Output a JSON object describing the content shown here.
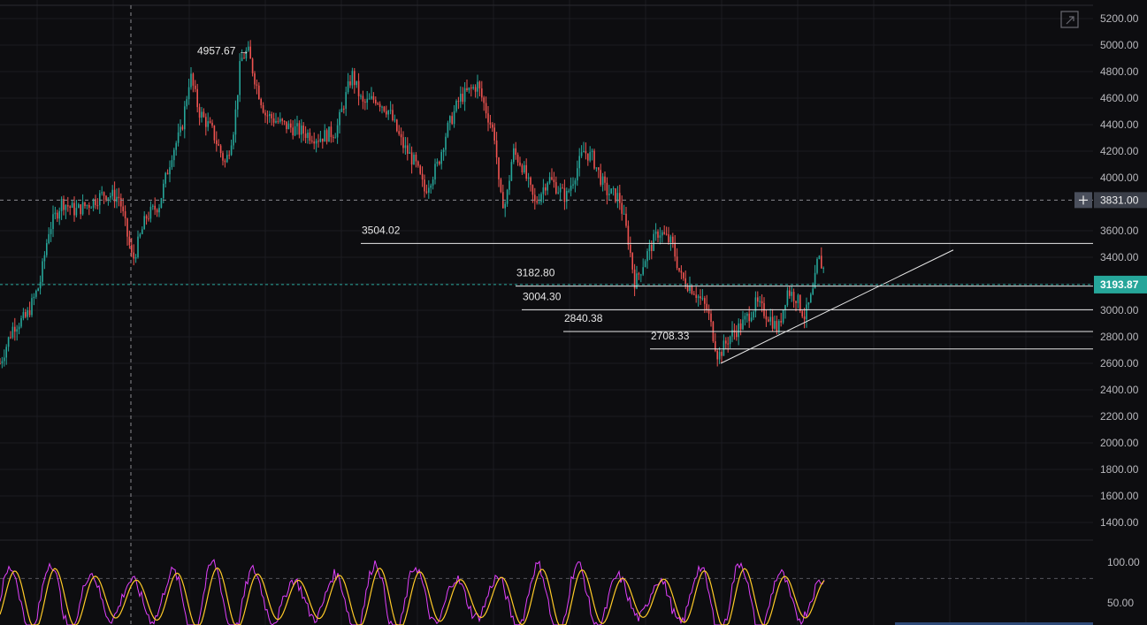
{
  "chart_data": {
    "type": "candlestick",
    "y_axis": {
      "ticks": [
        "5200.00",
        "5000.00",
        "4800.00",
        "4600.00",
        "4400.00",
        "4200.00",
        "4000.00",
        "3600.00",
        "3400.00",
        "3200.00",
        "3000.00",
        "2800.00",
        "2600.00",
        "2400.00",
        "2200.00",
        "2000.00",
        "1800.00",
        "1600.00",
        "1400.00"
      ],
      "range": [
        1300,
        5280
      ],
      "position": "right"
    },
    "price_series": {
      "points": [
        [
          0,
          2600
        ],
        [
          15,
          2880
        ],
        [
          30,
          2950
        ],
        [
          45,
          3200
        ],
        [
          55,
          3600
        ],
        [
          70,
          3820
        ],
        [
          85,
          3750
        ],
        [
          100,
          3800
        ],
        [
          118,
          3880
        ],
        [
          135,
          3850
        ],
        [
          150,
          3370
        ],
        [
          165,
          3700
        ],
        [
          180,
          3800
        ],
        [
          195,
          4200
        ],
        [
          205,
          4350
        ],
        [
          215,
          4780
        ],
        [
          225,
          4500
        ],
        [
          240,
          4350
        ],
        [
          255,
          4100
        ],
        [
          265,
          4400
        ],
        [
          272,
          4880
        ],
        [
          280,
          4960
        ],
        [
          290,
          4700
        ],
        [
          300,
          4480
        ],
        [
          320,
          4400
        ],
        [
          340,
          4350
        ],
        [
          360,
          4300
        ],
        [
          380,
          4350
        ],
        [
          398,
          4780
        ],
        [
          410,
          4550
        ],
        [
          425,
          4600
        ],
        [
          440,
          4500
        ],
        [
          455,
          4250
        ],
        [
          470,
          4100
        ],
        [
          480,
          3900
        ],
        [
          495,
          4100
        ],
        [
          505,
          4350
        ],
        [
          520,
          4600
        ],
        [
          540,
          4700
        ],
        [
          550,
          4500
        ],
        [
          560,
          4300
        ],
        [
          565,
          3850
        ],
        [
          572,
          3800
        ],
        [
          580,
          4200
        ],
        [
          590,
          4100
        ],
        [
          605,
          3800
        ],
        [
          620,
          4000
        ],
        [
          640,
          3850
        ],
        [
          660,
          4200
        ],
        [
          670,
          4150
        ],
        [
          685,
          3900
        ],
        [
          700,
          3850
        ],
        [
          710,
          3550
        ],
        [
          718,
          3200
        ],
        [
          730,
          3400
        ],
        [
          745,
          3600
        ],
        [
          760,
          3500
        ],
        [
          770,
          3250
        ],
        [
          785,
          3150
        ],
        [
          800,
          3000
        ],
        [
          812,
          2650
        ],
        [
          825,
          2800
        ],
        [
          840,
          2900
        ],
        [
          855,
          3050
        ],
        [
          870,
          2950
        ],
        [
          880,
          2850
        ],
        [
          890,
          3150
        ],
        [
          900,
          3100
        ],
        [
          910,
          2950
        ],
        [
          920,
          3150
        ],
        [
          925,
          3400
        ],
        [
          932,
          3300
        ]
      ]
    },
    "reference_levels": [
      {
        "value": 3504.02,
        "label": "3504.02"
      },
      {
        "value": 3182.8,
        "label": "3182.80"
      },
      {
        "value": 3004.3,
        "label": "3004.30"
      },
      {
        "value": 2840.38,
        "label": "2840.38"
      },
      {
        "value": 2708.33,
        "label": "2708.33"
      }
    ],
    "high_marker": {
      "value": 4957.67,
      "label": "4957.67 →"
    },
    "current_price": {
      "value": 3193.87,
      "label": "3193.87",
      "color": "#26a69a"
    },
    "crosshair": {
      "value": 3831.0,
      "label": "3831.00"
    },
    "trendline": {
      "from": [
        815,
        2600
      ],
      "to": [
        1078,
        3455
      ]
    },
    "oscillator": {
      "ticks": [
        "100.00",
        "50.00"
      ],
      "levels": [
        80,
        20
      ]
    },
    "colors": {
      "background": "#0d0d10",
      "up": "#26a69a",
      "down": "#ef5350",
      "osc_k": "#e040fb",
      "osc_d": "#ffca28"
    }
  }
}
